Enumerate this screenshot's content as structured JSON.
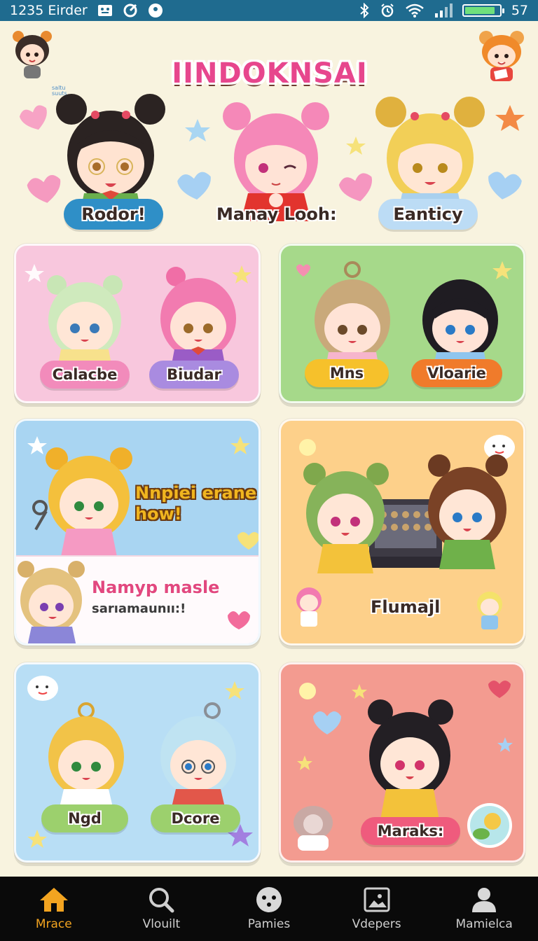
{
  "status_bar": {
    "time": "1235 Eirder",
    "battery_level": "57",
    "battery_percent": 88
  },
  "header": {
    "app_title": "IINDOKNSAI",
    "tiny_note": "saltu\nsuuts",
    "characters": [
      {
        "label": "Rodor!",
        "color": "#2f8fc7"
      },
      {
        "label": "Manay Looh:",
        "color": "transparent"
      },
      {
        "label": "Eanticy",
        "color": "#bcdcf5"
      }
    ]
  },
  "cards": [
    {
      "id": "pink",
      "bg": "#f8c7dd",
      "labels": [
        {
          "text": "Calacbe",
          "color": "#f28bbb"
        },
        {
          "text": "Biudar",
          "color": "#a98be0"
        }
      ]
    },
    {
      "id": "green",
      "bg": "#a6d98a",
      "labels": [
        {
          "text": "Mns",
          "color": "#f6c12b"
        },
        {
          "text": "Vloarie",
          "color": "#f07b2b"
        }
      ]
    },
    {
      "id": "blue",
      "bg": "#a9d5f2",
      "headline": "Nnpiei erane\nhow!",
      "banner_title": "Namyp masle",
      "banner_sub": "sarıamaunıı:!"
    },
    {
      "id": "orange",
      "bg": "#fdd08a",
      "label": "Flumajl"
    },
    {
      "id": "skyblue",
      "bg": "#b8def5",
      "labels": [
        {
          "text": "Ngd",
          "color": "#9cd06d"
        },
        {
          "text": "Dcore",
          "color": "#9cd06d"
        }
      ]
    },
    {
      "id": "coral",
      "bg": "#f39b90",
      "labels": [
        {
          "text": "Maraks:",
          "color": "#ef5b7d"
        }
      ]
    }
  ],
  "bottom_nav": [
    {
      "label": "Mrace",
      "icon": "home-icon",
      "active": true
    },
    {
      "label": "Vlouilt",
      "icon": "search-icon",
      "active": false
    },
    {
      "label": "Pamies",
      "icon": "face-icon",
      "active": false
    },
    {
      "label": "Vdepers",
      "icon": "gallery-icon",
      "active": false
    },
    {
      "label": "Mamielca",
      "icon": "profile-icon",
      "active": false
    }
  ],
  "colors": {
    "status_bar": "#1f6b8f",
    "background": "#f8f3df",
    "nav_bg": "#0a0a0a",
    "nav_active": "#f3a420",
    "title_pink": "#e7468d"
  }
}
